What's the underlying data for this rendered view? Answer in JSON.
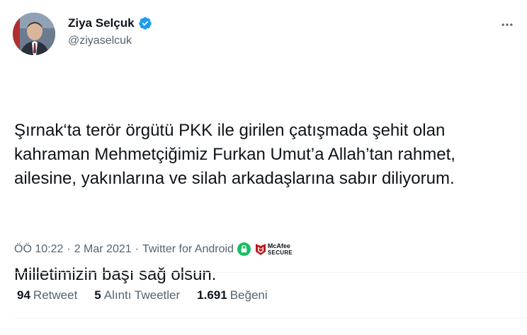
{
  "author": {
    "name": "Ziya Selçuk",
    "handle": "@ziyaselcuk",
    "verified": true
  },
  "tweet": {
    "paragraph1": "Şırnak‘ta terör örgütü PKK ile girilen çatışmada şehit olan kahraman Mehmetçiğimiz Furkan Umut’a Allah’tan rahmet, ailesine, yakınlarına ve silah arkadaşlarına sabır diliyorum.",
    "paragraph2": "Milletimizin başı sağ olsun."
  },
  "meta": {
    "time": "ÖÖ 10:22",
    "sep1": "·",
    "date": "2 Mar 2021",
    "sep2": "·",
    "source": "Twitter for Android",
    "badge_top": "McAfee",
    "badge_bottom": "SECURE"
  },
  "stats": {
    "retweets_count": "94",
    "retweets_label": "Retweet",
    "quotes_count": "5",
    "quotes_label": "Alıntı Tweetler",
    "likes_count": "1.691",
    "likes_label": "Beğeni"
  },
  "colors": {
    "verified": "#1d9bf0",
    "secondary_text": "#536471",
    "lock_green": "#17bf63",
    "mcafee_red": "#c01818"
  },
  "icons": {
    "verified": "verified-badge-icon",
    "more": "more-dots-icon",
    "lock": "lock-icon",
    "mcafee": "mcafee-shield-icon"
  }
}
